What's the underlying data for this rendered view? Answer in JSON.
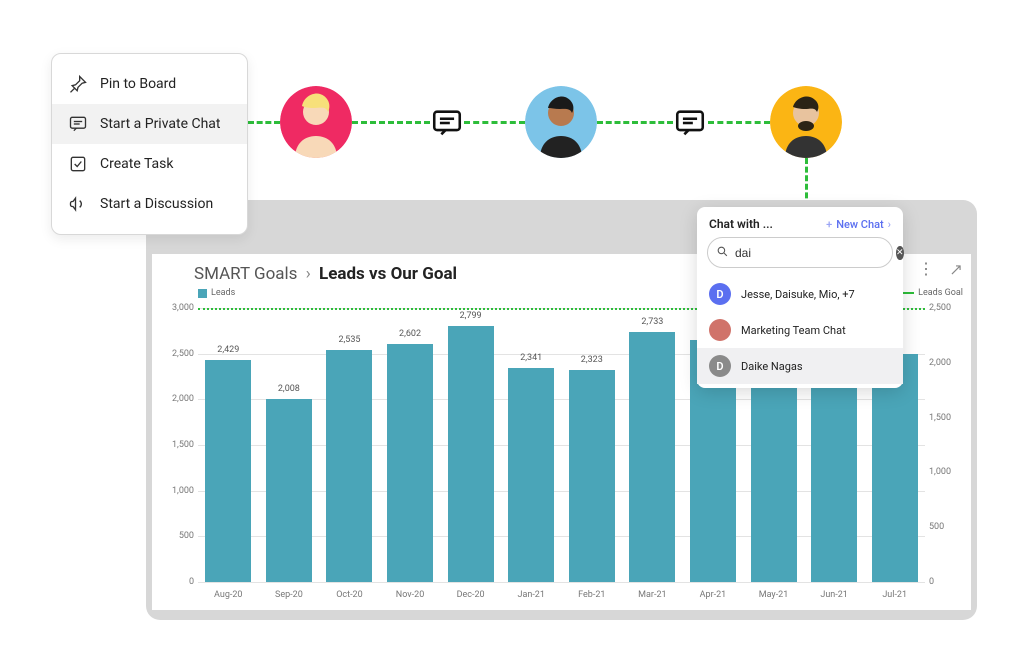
{
  "context_menu": {
    "items": [
      {
        "label": "Pin to Board",
        "icon": "pin-icon",
        "active": false
      },
      {
        "label": "Start a Private Chat",
        "icon": "chat-icon",
        "active": true
      },
      {
        "label": "Create Task",
        "icon": "task-icon",
        "active": false
      },
      {
        "label": "Start a Discussion",
        "icon": "megaphone-icon",
        "active": false
      }
    ]
  },
  "breadcrumb": {
    "parent": "SMART Goals",
    "sep": "›",
    "current": "Leads vs Our Goal"
  },
  "legend": {
    "left": "Leads",
    "right": "Leads Goal"
  },
  "chat": {
    "title": "Chat with ...",
    "new_chat": "New Chat",
    "search_value": "dai",
    "items": [
      {
        "label": "Jesse, Daisuke, Mio, +7",
        "avatar_bg": "#5b6ff0",
        "avatar_letter": "D",
        "highlight": false
      },
      {
        "label": "Marketing Team Chat",
        "avatar_bg": "#d0736a",
        "avatar_letter": "",
        "highlight": false
      },
      {
        "label": "Daike Nagas",
        "avatar_bg": "#8a8a8a",
        "avatar_letter": "D",
        "highlight": true
      }
    ]
  },
  "chart_data": {
    "type": "bar",
    "categories": [
      "Aug-20",
      "Sep-20",
      "Oct-20",
      "Nov-20",
      "Dec-20",
      "Jan-21",
      "Feb-21",
      "Mar-21",
      "Apr-21",
      "May-21",
      "Jun-21",
      "Jul-21"
    ],
    "values": [
      2429,
      2008,
      2535,
      2602,
      2799,
      2341,
      2323,
      2733,
      2650,
      2500,
      2500,
      2500
    ],
    "visible_value_labels": [
      2429,
      2008,
      2535,
      2602,
      2799,
      2341,
      2323,
      2733,
      null,
      null,
      null,
      null
    ],
    "goal_line_value": 3000,
    "y_left": {
      "min": 0,
      "max": 3000,
      "step": 500
    },
    "y_right": {
      "min": 0,
      "max": 2500,
      "step": 500
    },
    "title_parent": "SMART Goals",
    "title": "Leads vs Our Goal",
    "series_left_name": "Leads",
    "series_right_name": "Leads Goal"
  }
}
